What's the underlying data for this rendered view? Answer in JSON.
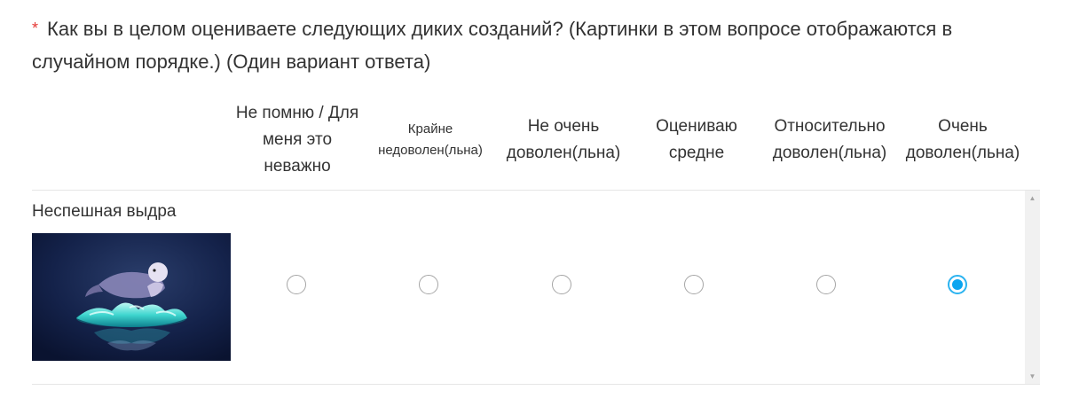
{
  "question": {
    "required_mark": "*",
    "text": "Как вы в целом оцениваете следующих диких созданий? (Картинки в этом вопросе отображаются в случайном порядке.)",
    "hint": "(Один вариант ответа)"
  },
  "columns": [
    {
      "label": "Не помню / Для меня это неважно"
    },
    {
      "label": "Крайне недоволен(льна)"
    },
    {
      "label": "Не очень доволен(льна)"
    },
    {
      "label": "Оцениваю средне"
    },
    {
      "label": "Относительно доволен(льна)"
    },
    {
      "label": "Очень доволен(льна)"
    }
  ],
  "rows": [
    {
      "label": "Неспешная выдра",
      "image": "otter-floating-over-water-splash",
      "selected_column": 5
    }
  ],
  "scrollbar": {
    "up_icon": "scroll-up-arrow-icon",
    "down_icon": "scroll-down-arrow-icon"
  },
  "colors": {
    "required": "#e53935",
    "radio_selected": "#0aa5f0",
    "radio_border": "#a6a6a6",
    "divider": "#e6e6e6"
  }
}
